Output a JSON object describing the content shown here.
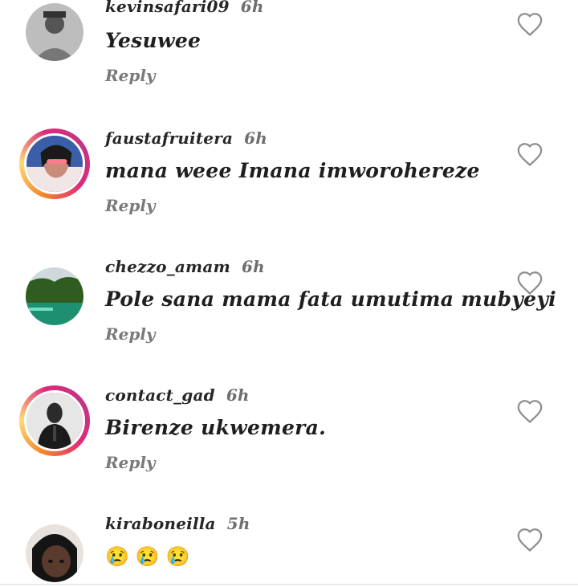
{
  "comments": [
    {
      "username": "kevinsafari09",
      "time": "6h",
      "text": "Yesuwee",
      "reply": "Reply"
    },
    {
      "username": "faustafruitera",
      "time": "6h",
      "text": "mana weee Imana imworohereze",
      "reply": "Reply"
    },
    {
      "username": "chezzo_amam",
      "time": "6h",
      "text": "Pole sana mama fata umutima mubyeyi",
      "reply": "Reply"
    },
    {
      "username": "contact_gad",
      "time": "6h",
      "text": "Birenze ukwemera.",
      "reply": "Reply"
    },
    {
      "username": "kiraboneilla",
      "time": "5h",
      "text": "😢😢😢",
      "reply": ""
    }
  ],
  "icons": {
    "like": "heart-outline-icon"
  },
  "colors": {
    "text": "#1f1f1f",
    "muted": "#7a7a7a",
    "ring": "#dd2a7b",
    "emoji": "#1a37c8"
  }
}
